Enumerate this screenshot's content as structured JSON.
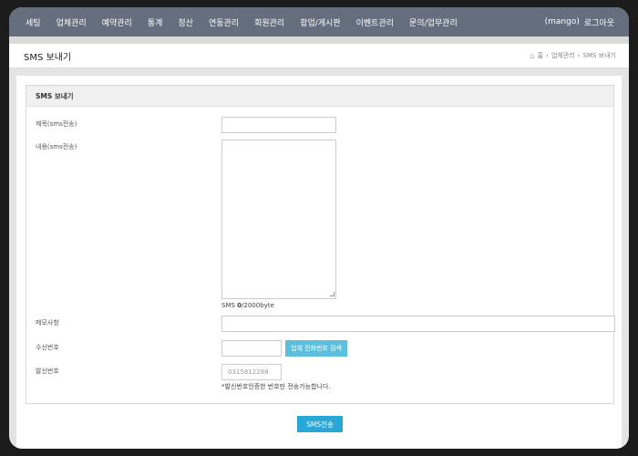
{
  "nav": {
    "items": [
      "세팅",
      "업체관리",
      "예약관리",
      "통계",
      "정산",
      "연동관리",
      "회원관리",
      "팝업/게시판",
      "이벤트관리",
      "문의/업무관리"
    ],
    "user": "(mango)",
    "logout": "로그아웃"
  },
  "page": {
    "title": "SMS 보내기",
    "breadcrumb": [
      "홈",
      "업체관리",
      "SMS 보내기"
    ]
  },
  "form": {
    "panel_title": "SMS 보내기",
    "subject_label": "제목(sms전송)",
    "subject_value": "",
    "content_label": "내용(sms전송)",
    "content_value": "",
    "counter_prefix": "SMS ",
    "counter_value": "0",
    "counter_suffix": "/2000byte",
    "memo_label": "메모사항",
    "memo_value": "",
    "receiver_label": "수신번호",
    "receiver_value": "",
    "search_button": "업체 전화번호 검색",
    "sender_label": "발신번호",
    "sender_placeholder": "0315812288",
    "sender_note": "*발신번호인증한 번호만 전송가능합니다.",
    "send_button": "SMS전송"
  },
  "colors": {
    "nav_bg": "#646e7c",
    "accent_button": "#5bc0de",
    "send_button": "#29a8d8"
  }
}
